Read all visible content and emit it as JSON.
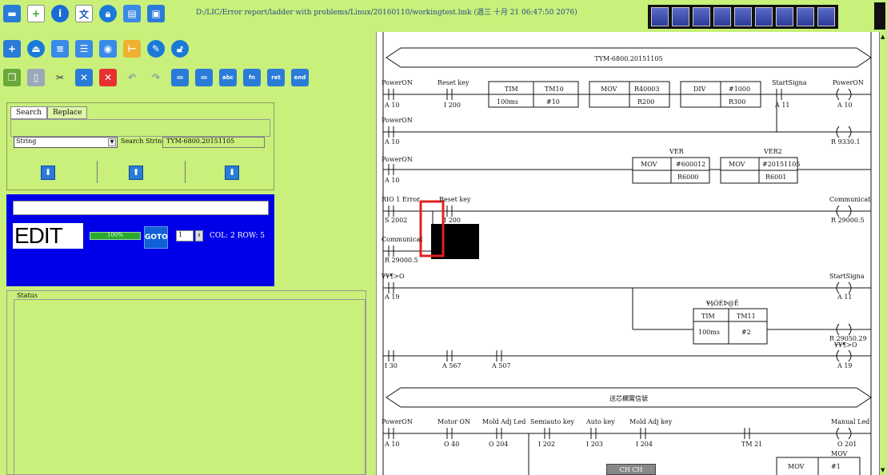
{
  "window": {
    "path": "D:/LIC/Error report/ladder with problems/Linux/20160110/workingtest.lmk (週三 十月 21 06:47:50 2076)"
  },
  "toolbar": {
    "row1_icons": [
      "folder-icon",
      "add-page-icon",
      "info-icon",
      "translate-icon",
      "lock-icon",
      "save-icon",
      "save-remove-icon"
    ],
    "row2_icons": [
      "export-icon",
      "eject-icon",
      "document-icon",
      "list-icon",
      "view-icon",
      "switch-icon",
      "edit-icon",
      "unlock-icon"
    ],
    "row3_icons": [
      "copy-icon",
      "paste-icon",
      "cut-icon",
      "delete-row-icon",
      "delete-icon",
      "undo-icon",
      "redo-icon",
      "insert-row-icon",
      "insert-row-alt-icon",
      "insert-abc-icon",
      "insert-func-icon",
      "insert-ret-icon",
      "insert-end-icon"
    ],
    "window_buttons": [
      "view-1",
      "view-2",
      "view-3",
      "view-4",
      "view-5",
      "view-6",
      "view-7",
      "view-8",
      "view-9"
    ]
  },
  "search": {
    "tab_search": "Search",
    "tab_replace": "Replace",
    "type_value": "String",
    "string_label": "Search String",
    "string_value": "TYM-6800.20151105"
  },
  "edit": {
    "label": "EDIT",
    "progress_text": "100%",
    "progress_value": 100,
    "goto_label": "GOTO",
    "goto_value": "1",
    "col_row": "COL: 2 ROW: 5"
  },
  "status": {
    "title": "Status"
  },
  "ladder": {
    "header1": "TYM-6800.20151105",
    "header2": "送芯欄實信號",
    "rung1": {
      "c1_name": "PowerON",
      "c1_addr": "A 10",
      "c2_name": "Reset key",
      "c2_addr": "I 200",
      "tim_op": "TIM",
      "tim_a": "TM10",
      "tim_b": "100ms",
      "tim_c": "#10",
      "mov_op": "MOV",
      "mov_a": "R40003",
      "mov_b": "R200",
      "div_op": "DIV",
      "div_a": "#1000",
      "div_b": "R300",
      "c3_name": "StartSigna",
      "c3_addr": "A 11",
      "coil_name": "PowerON",
      "coil_addr": "A 10"
    },
    "rung2": {
      "c_name": "PowerON",
      "c_addr": "A 10",
      "coil_addr": "R 9330.1"
    },
    "rung3": {
      "c_name": "PowerON",
      "c_addr": "A 10",
      "ver_label": "VER",
      "mov1_op": "MOV",
      "mov1_a": "#600012",
      "mov1_b": "R6000",
      "ver2_label": "VER2",
      "mov2_op": "MOV",
      "mov2_a": "#20151105",
      "mov2_b": "R6001"
    },
    "rung4": {
      "c1_name": "RIO 1 Error",
      "c1_addr": "S 2002",
      "c2_name": "Reset key",
      "c2_addr": "I 200",
      "coil_name": "Communicat",
      "coil_addr": "R 29000.5",
      "c3_name": "Communicat",
      "c3_addr": "R 29000.5"
    },
    "rung5": {
      "c_name": "¥¥¶>O",
      "c_addr": "A 19",
      "coil_name": "StartSigna",
      "coil_addr": "A 11",
      "tim_label": "¥§ÓÈÞ@Ê",
      "tim_op": "TIM",
      "tim_a": "TM11",
      "tim_b": "100ms",
      "tim_c": "#2",
      "coil2_addr": "R 29050.29"
    },
    "rung6": {
      "c1_addr": "I 30",
      "c2_addr": "A 567",
      "c3_addr": "A 507",
      "coil_name": "¥¥¶>O",
      "coil_addr": "A 19"
    },
    "rung7": {
      "c1_name": "PowerON",
      "c1_addr": "A 10",
      "c2_name": "Motor ON",
      "c2_addr": "O 40",
      "c3_name": "Mold Adj Led",
      "c3_addr": "O 204",
      "c4_name": "Semiauto key",
      "c4_addr": "I 202",
      "c5_name": "Auto key",
      "c5_addr": "I 203",
      "c6_name": "Mold Adj key",
      "c6_addr": "I 204",
      "c7_addr": "TM 21",
      "coil_name": "Manual Led",
      "coil_addr": "O 201",
      "mov_label": "MOV",
      "mov_op": "MOV",
      "mov_a": "#1"
    }
  },
  "chch_label": "CH CH"
}
